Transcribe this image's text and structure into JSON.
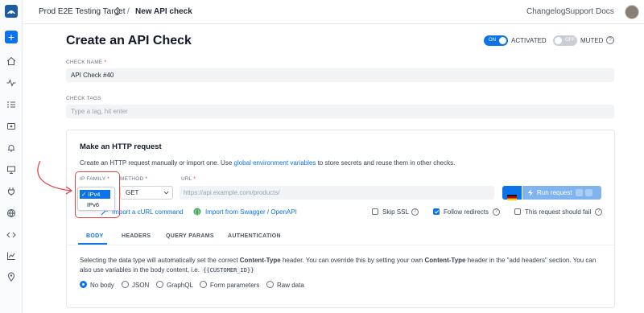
{
  "header": {
    "project": "Prod E2E Testing Target",
    "separator": "/",
    "current": "New API check",
    "links": [
      "Changelog",
      "Support",
      "Docs"
    ]
  },
  "page": {
    "title": "Create an API Check",
    "activated_toggle": "ON",
    "activated_label": "ACTIVATED",
    "muted_toggle": "OFF",
    "muted_label": "MUTED"
  },
  "form": {
    "check_name_label": "CHECK NAME",
    "check_name_value": "API Check #40",
    "check_tags_label": "CHECK TAGS",
    "check_tags_placeholder": "Type a tag, hit enter",
    "required_mark": "*"
  },
  "request": {
    "title": "Make an HTTP request",
    "desc_before": "Create an HTTP request manually or import one. Use ",
    "desc_link": "global environment variables",
    "desc_after": " to store secrets and reuse them in other checks.",
    "ip_family_label": "IP FAMILY",
    "method_label": "METHOD",
    "url_label": "URL",
    "method_value": "GET",
    "url_placeholder": "https://api.example.com/products/",
    "ip_options": [
      "✓ IPv4",
      "IPv6"
    ],
    "run_label": "Run request",
    "import_curl": "Import a cURL command",
    "import_swagger": "Import from Swagger / OpenAPI",
    "skip_ssl": "Skip SSL",
    "follow_redirects": "Follow redirects",
    "should_fail": "This request should fail"
  },
  "tabs": [
    "BODY",
    "HEADERS",
    "QUERY PARAMS",
    "AUTHENTICATION"
  ],
  "body": {
    "desc1": "Selecting the data type will automatically set the correct ",
    "ct": "Content-Type",
    "desc2": " header. You can override this by setting your own ",
    "ct2": "Content-Type",
    "desc3": " header in the \"add headers\" section. You can also use variables in the body content, i.e. ",
    "var": "{{CUSTOMER_ID}}",
    "options": [
      "No body",
      "JSON",
      "GraphQL",
      "Form parameters",
      "Raw data"
    ]
  },
  "colors": {
    "accent": "#0d73e8",
    "highlight": "#e04848"
  }
}
